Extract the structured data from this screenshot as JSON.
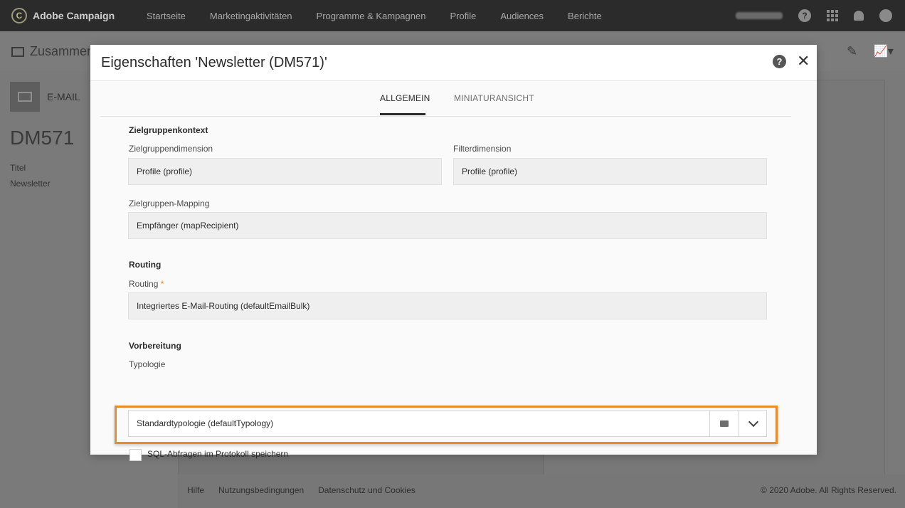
{
  "app": {
    "brand": "Adobe Campaign",
    "nav": [
      "Startseite",
      "Marketingaktivitäten",
      "Programme & Kampagnen",
      "Profile",
      "Audiences",
      "Berichte"
    ]
  },
  "background": {
    "page_title": "Zusammen",
    "channel_label": "E-MAIL",
    "delivery_id": "DM571",
    "title_label": "Titel",
    "title_value": "Newsletter",
    "footer_links": [
      "Hilfe",
      "Nutzungsbedingungen",
      "Datenschutz und Cookies"
    ],
    "copyright": "© 2020 Adobe. All Rights Reserved."
  },
  "modal": {
    "title": "Eigenschaften 'Newsletter (DM571)'",
    "tabs": [
      {
        "label": "ALLGEMEIN",
        "active": true
      },
      {
        "label": "MINIATURANSICHT",
        "active": false
      }
    ],
    "sections": {
      "target_context": {
        "title": "Zielgruppenkontext",
        "target_dimension_label": "Zielgruppendimension",
        "target_dimension_value": "Profile (profile)",
        "filter_dimension_label": "Filterdimension",
        "filter_dimension_value": "Profile (profile)",
        "target_mapping_label": "Zielgruppen-Mapping",
        "target_mapping_value": "Empfänger (mapRecipient)"
      },
      "routing": {
        "title": "Routing",
        "routing_label": "Routing",
        "required_mark": "*",
        "routing_value": "Integriertes E-Mail-Routing (defaultEmailBulk)"
      },
      "preparation": {
        "title": "Vorbereitung",
        "typology_label": "Typologie",
        "typology_value": "Standardtypologie (defaultTypology)",
        "sql_checkbox_label": "SQL-Abfragen im Protokoll speichern",
        "sql_checkbox_checked": false
      }
    }
  },
  "colors": {
    "highlight": "#e68c2d",
    "topbar": "#2b2b2b"
  }
}
